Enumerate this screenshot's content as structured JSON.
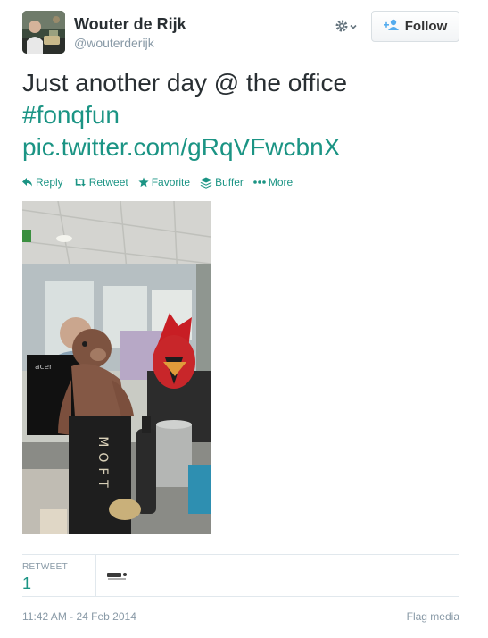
{
  "user": {
    "full_name": "Wouter de Rijk",
    "screen_name": "@wouterderijk"
  },
  "follow_label": "Follow",
  "tweet": {
    "text": "Just another day @ the office",
    "hashtag": "#fonqfun",
    "pic_link": "pic.twitter.com/gRqVFwcbnX"
  },
  "actions": {
    "reply": "Reply",
    "retweet": "Retweet",
    "favorite": "Favorite",
    "buffer": "Buffer",
    "more": "More"
  },
  "stats": {
    "retweet_label": "RETWEET",
    "retweet_count": "1"
  },
  "footer": {
    "timestamp": "11:42 AM - 24 Feb 2014",
    "flag": "Flag media"
  },
  "photo_text": {
    "box_lettering": "MOFT",
    "monitor_brand": "acer"
  },
  "colors": {
    "link": "#1b9484",
    "muted": "#8899a6",
    "text": "#292f33",
    "divider": "#e1e8ed"
  },
  "icons": [
    "gear-icon",
    "chevron-down-icon",
    "add-user-icon",
    "reply-icon",
    "retweet-icon",
    "star-icon",
    "buffer-icon",
    "more-icon"
  ]
}
